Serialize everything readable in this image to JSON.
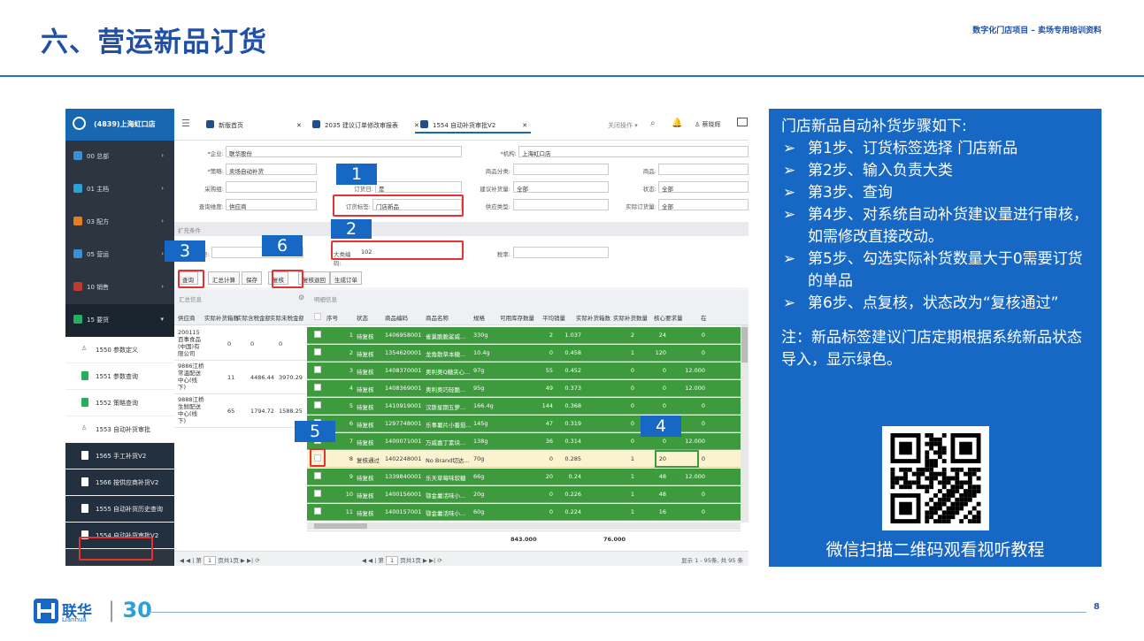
{
  "slide": {
    "title": "六、营运新品订货",
    "subtitle": "数字化门店项目 – 卖场专用培训资料",
    "page": "8"
  },
  "app": {
    "store": "(4839)上海虹口店",
    "menu": [
      {
        "label": "00 总部",
        "color": "#3a8fd6"
      },
      {
        "label": "01 主档",
        "color": "#2aa2d8"
      },
      {
        "label": "03 配方",
        "color": "#e67e22"
      },
      {
        "label": "05 营运",
        "color": "#3a8fd6"
      },
      {
        "label": "10 销售",
        "color": "#c0392b"
      },
      {
        "label": "15 要货",
        "color": "#27ae60"
      }
    ],
    "submenu": [
      "1550 参数定义",
      "1551 参数查询",
      "1552 策略查询",
      "1553 自动补货审批",
      "1565 手工补货V2",
      "1566 按供应商补货V2",
      "1555 自动补货历史查询",
      "1554 自动补货审批V2"
    ],
    "tabs": [
      "新版首页",
      "2035 建议订单修改审报表",
      "1554 自动补货审批V2"
    ],
    "toolbar": {
      "close_ops": "关闭操作 ▾",
      "user": "蔡晓辉"
    },
    "form": {
      "company_label": "*企业:",
      "company": "联华股份",
      "org_label": "*机构:",
      "org": "上海虹口店",
      "strategy_label": "*策略:",
      "strategy": "卖场自动补货",
      "category_label": "商品分类:",
      "goods_label": "商品:",
      "buyer_label": "采购组:",
      "order_day_label": "订货日:",
      "order_day": "是",
      "suggest_label": "建议补货量:",
      "suggest": "全部",
      "status_label": "状态:",
      "status": "全部",
      "query_label": "查询维度:",
      "query": "供应商",
      "tag_label": "订货标签:",
      "tag": "门店新品",
      "supplier_type_label": "供应类型:",
      "actual_label": "实际订货量:",
      "actual": "全部"
    },
    "ext_label": "扩充条件",
    "ext": {
      "sup_label": "号:",
      "cat_label": "大类编码:",
      "cat": "102",
      "tax_label": "税率:"
    },
    "buttons": [
      "查询",
      "汇总计算",
      "保存",
      "复核",
      "复核退回",
      "生成订单"
    ],
    "summary_label": "汇总信息",
    "detail_label": "明细信息",
    "left_headers": [
      "供应商",
      "实际补货箱数",
      "实际含税金额",
      "实际未税金额"
    ],
    "left_rows": [
      {
        "sup": "200115百事食品(中国)有限公司",
        "a": "0",
        "b": "0",
        "c": "0"
      },
      {
        "sup": "9886江桥常温配送中心(线下)",
        "a": "11",
        "b": "4486.44",
        "c": "3970.29"
      },
      {
        "sup": "9888江桥生鲜配送中心(线下)",
        "a": "65",
        "b": "1794.72",
        "c": "1588.25"
      }
    ],
    "right_headers": [
      "序号",
      "状态",
      "商品编码",
      "商品名称",
      "规格",
      "可用库存数量",
      "平均销量",
      "实际补货箱数",
      "实际补货数量",
      "核心要求量",
      "在"
    ],
    "right_rows": [
      [
        "1",
        "待复核",
        "1406958001",
        "雀巢脆脆鲨威...",
        "330g",
        "2",
        "1.037",
        "2",
        "24",
        "0"
      ],
      [
        "2",
        "待复核",
        "1354620001",
        "龙角散草本糖...",
        "10.4g",
        "0",
        "0.458",
        "1",
        "120",
        "0"
      ],
      [
        "3",
        "待复核",
        "1408370001",
        "奥利奥Q糖夹心...",
        "97g",
        "55",
        "0.452",
        "0",
        "0",
        "12.000"
      ],
      [
        "4",
        "待复核",
        "1408369001",
        "奥利奥巧轻脆...",
        "95g",
        "49",
        "0.373",
        "0",
        "0",
        "12.000"
      ],
      [
        "5",
        "待复核",
        "1410919001",
        "汉斯星期五萝...",
        "166.4g",
        "144",
        "0.368",
        "0",
        "0",
        "0"
      ],
      [
        "6",
        "待复核",
        "1297748001",
        "乐事薯片小番茄...",
        "145g",
        "47",
        "0.319",
        "0",
        "0",
        "0"
      ],
      [
        "7",
        "待复核",
        "1400071001",
        "万威嘉丁素块...",
        "138g",
        "36",
        "0.314",
        "0",
        "0",
        "12.000"
      ],
      [
        "8",
        "复核通过",
        "1402248001",
        "No Brand切达...",
        "70g",
        "0",
        "0.285",
        "1",
        "20",
        "0"
      ],
      [
        "9",
        "待复核",
        "1339840001",
        "乐天草莓味软糖",
        "66g",
        "20",
        "0.24",
        "1",
        "48",
        "12.000"
      ],
      [
        "10",
        "待复核",
        "1400156001",
        "鄂金薯活味小...",
        "20g",
        "0",
        "0.226",
        "1",
        "48",
        "0"
      ],
      [
        "11",
        "待复核",
        "1400157001",
        "鄂金薯活味小...",
        "60g",
        "0",
        "0.224",
        "1",
        "16",
        "0"
      ]
    ],
    "totals": {
      "stock": "843.000",
      "qty": "76.000"
    },
    "pager": {
      "page_left": "第",
      "page_val": "1",
      "of": "页共1页",
      "display": "显示 1 - 95条, 共 95 条"
    }
  },
  "callouts": [
    "1",
    "2",
    "3",
    "4",
    "5",
    "6"
  ],
  "info": {
    "heading": "门店新品自动补货步骤如下:",
    "steps": [
      "第1步、订货标签选择 门店新品",
      "第2步、输入负责大类",
      "第3步、查询",
      "第4步、对系统自动补货建议量进行审核，如需修改直接改动。",
      "第5步、勾选实际补货数量大于0需要订货的单品",
      "第6步、点复核，状态改为“复核通过”"
    ],
    "note": "注：新品标签建议门店定期根据系统新品状态导入，显示绿色。",
    "qr_caption": "微信扫描二维码观看视听教程"
  },
  "brand": {
    "name": "联华",
    "en": "Lianhua",
    "anni": "30"
  }
}
